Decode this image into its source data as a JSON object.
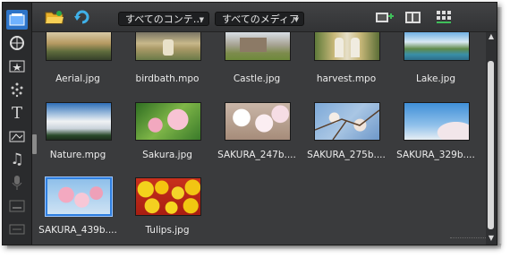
{
  "toolbar": {
    "filter_content": "すべてのコンテ…",
    "filter_media": "すべてのメディア"
  },
  "icons": {
    "sidebar": [
      "media-library-icon",
      "transitions-icon",
      "effects-icon",
      "particles-icon",
      "title-icon",
      "graphics-icon",
      "music-icon",
      "record-icon",
      "subtitle-icon",
      "chapter-icon"
    ],
    "toolbar": [
      "open-folder-icon",
      "refresh-icon",
      "add-clip-icon",
      "storyboard-icon",
      "grid-view-icon"
    ]
  },
  "media": [
    {
      "name": "Aerial.jpg"
    },
    {
      "name": "birdbath.mpo"
    },
    {
      "name": "Castle.jpg"
    },
    {
      "name": "harvest.mpo"
    },
    {
      "name": "Lake.jpg"
    },
    {
      "name": "Nature.mpg"
    },
    {
      "name": "Sakura.jpg"
    },
    {
      "name": "SAKURA_247b...."
    },
    {
      "name": "SAKURA_275b...."
    },
    {
      "name": "SAKURA_329b...."
    },
    {
      "name": "SAKURA_439b...."
    },
    {
      "name": "Tulips.jpg"
    }
  ],
  "selected_index": 10,
  "colors": {
    "accent": "#2d74c9",
    "background": "#3a3b3d"
  }
}
